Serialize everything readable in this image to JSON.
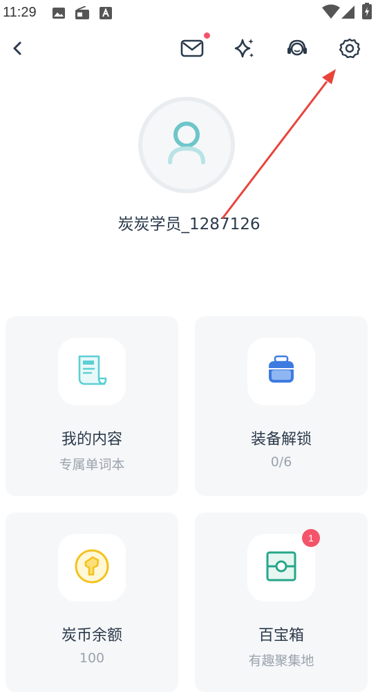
{
  "status_bar": {
    "time": "11:29",
    "icons": [
      "image-icon",
      "radio-icon",
      "text-a-icon",
      "wifi-icon",
      "signal-icon",
      "battery-icon"
    ]
  },
  "top_bar": {
    "icons": [
      "back-icon",
      "mail-icon",
      "sparkle-icon",
      "headset-icon",
      "settings-icon"
    ]
  },
  "profile": {
    "username": "炭炭学员_1287126"
  },
  "cards": [
    {
      "title": "我的内容",
      "subtitle": "专属单词本",
      "icon": "notebook-icon",
      "icon_color": "#5ccfd4"
    },
    {
      "title": "装备解锁",
      "subtitle": "0/6",
      "icon": "backpack-icon",
      "icon_color": "#3d7be0"
    },
    {
      "title": "炭币余额",
      "subtitle": "100",
      "icon": "coin-icon",
      "icon_color": "#f4c21f"
    },
    {
      "title": "百宝箱",
      "subtitle": "有趣聚集地",
      "icon": "treasure-box-icon",
      "icon_color": "#25a68a",
      "badge": "1"
    }
  ],
  "colors": {
    "accent_red": "#f4546a",
    "annotation_arrow": "#e8443a",
    "card_bg": "#f6f7f9",
    "avatar_teal": "#6ec6c9"
  }
}
